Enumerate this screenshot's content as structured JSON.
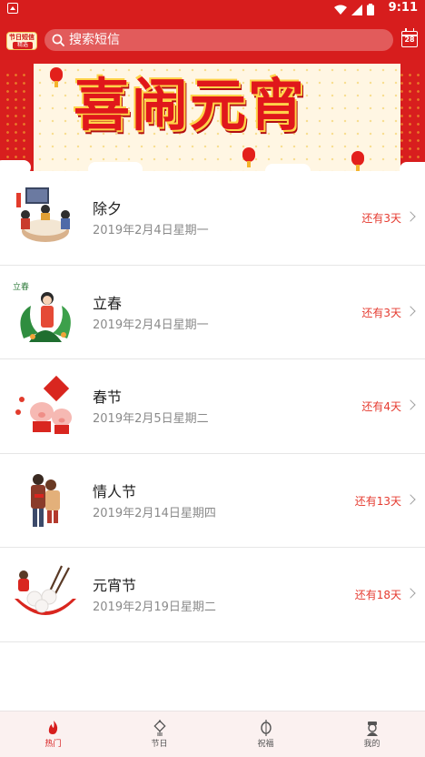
{
  "status_bar": {
    "time": "9:11"
  },
  "header": {
    "logo_line1": "节日短信",
    "logo_line2": "精选",
    "search_placeholder": "搜索短信",
    "calendar_day": "28"
  },
  "banner": {
    "title": "喜闹元宵"
  },
  "festivals": [
    {
      "name": "除夕",
      "date": "2019年2月4日星期一",
      "countdown": "还有3天",
      "icon": "family-dinner-icon"
    },
    {
      "name": "立春",
      "date": "2019年2月4日星期一",
      "countdown": "还有3天",
      "icon": "spring-girl-icon",
      "thumb_text": "立春"
    },
    {
      "name": "春节",
      "date": "2019年2月5日星期二",
      "countdown": "还有4天",
      "icon": "new-year-pigs-icon"
    },
    {
      "name": "情人节",
      "date": "2019年2月14日星期四",
      "countdown": "还有13天",
      "icon": "couple-hug-icon"
    },
    {
      "name": "元宵节",
      "date": "2019年2月19日星期二",
      "countdown": "还有18天",
      "icon": "rice-dumpling-bowl-icon"
    }
  ],
  "tabs": [
    {
      "label": "热门",
      "icon": "fire-icon",
      "active": true
    },
    {
      "label": "节日",
      "icon": "chinese-knot-icon",
      "active": false
    },
    {
      "label": "祝福",
      "icon": "lantern-icon",
      "active": false
    },
    {
      "label": "我的",
      "icon": "user-icon",
      "active": false
    }
  ],
  "colors": {
    "brand_red": "#d71d1d",
    "countdown_red": "#e53a2f",
    "tab_bg": "#fbf1f0"
  }
}
